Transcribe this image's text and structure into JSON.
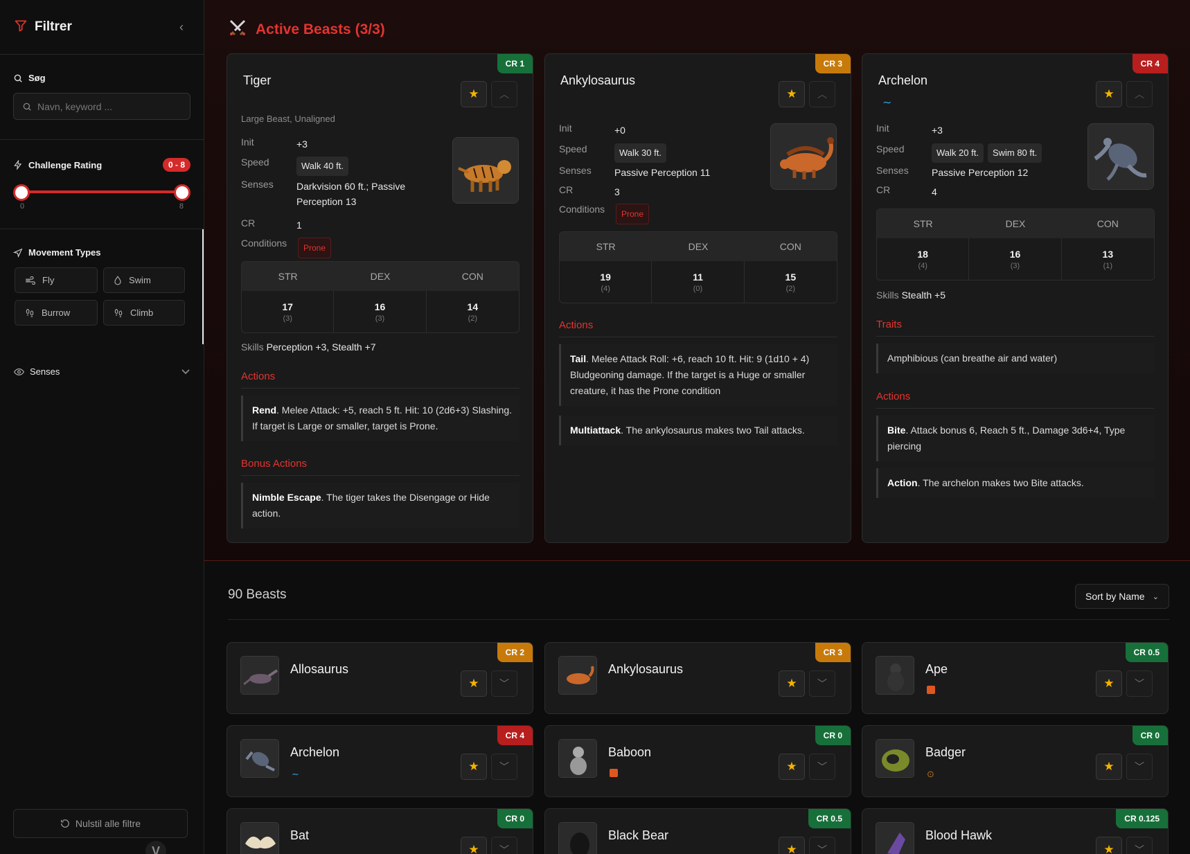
{
  "sidebar": {
    "title": "Filtrer",
    "search": {
      "label": "Søg",
      "placeholder": "Navn, keyword ..."
    },
    "challenge": {
      "label": "Challenge Rating",
      "badge": "0 - 8",
      "min_label": "0",
      "max_label": "8",
      "min_value": 0,
      "max_value": 8,
      "range_min": 0,
      "range_max": 8
    },
    "movement": {
      "label": "Movement Types",
      "types": [
        "Fly",
        "Swim",
        "Burrow",
        "Climb"
      ]
    },
    "senses": {
      "label": "Senses"
    },
    "reset_label": "Nulstil alle filtre",
    "logo_glyph": "V"
  },
  "active": {
    "title": "Active Beasts (3/3)",
    "cards": [
      {
        "name": "Tiger",
        "cr": "CR 1",
        "cr_color": "#17703a",
        "subtitle": "Large Beast, Unaligned",
        "init_label": "Init",
        "init": "+3",
        "speed_label": "Speed",
        "speeds": [
          "Walk 40 ft."
        ],
        "senses_label": "Senses",
        "senses": "Darkvision 60 ft.; Passive Perception 13",
        "cr_label": "CR",
        "cr_value": "1",
        "conditions_label": "Conditions",
        "conditions": "Prone",
        "abilities": {
          "headers": [
            "STR",
            "DEX",
            "CON"
          ],
          "values": [
            "17",
            "16",
            "14"
          ],
          "mods": [
            "(3)",
            "(3)",
            "(2)"
          ]
        },
        "skills_label": "Skills",
        "skills": "Perception +3, Stealth +7",
        "actions_title": "Actions",
        "actions": [
          {
            "name": "Rend",
            "text": ". Melee Attack: +5, reach 5 ft. Hit: 10 (2d6+3) Slashing. If target is Large or smaller, target is Prone."
          }
        ],
        "bonus_title": "Bonus Actions",
        "bonus": [
          {
            "name": "Nimble Escape",
            "text": ". The tiger takes the Disengage or Hide action."
          }
        ]
      },
      {
        "name": "Ankylosaurus",
        "cr": "CR 3",
        "cr_color": "#c77a0a",
        "init_label": "Init",
        "init": "+0",
        "speed_label": "Speed",
        "speeds": [
          "Walk 30 ft."
        ],
        "senses_label": "Senses",
        "senses": "Passive Perception 11",
        "cr_label": "CR",
        "cr_value": "3",
        "conditions_label": "Conditions",
        "conditions": "Prone",
        "abilities": {
          "headers": [
            "STR",
            "DEX",
            "CON"
          ],
          "values": [
            "19",
            "11",
            "15"
          ],
          "mods": [
            "(4)",
            "(0)",
            "(2)"
          ]
        },
        "actions_title": "Actions",
        "actions": [
          {
            "name": "Tail",
            "text": ". Melee Attack Roll: +6, reach 10 ft. Hit: 9 (1d10 + 4) Bludgeoning damage. If the target is a Huge or smaller creature, it has the Prone condition"
          },
          {
            "name": "Multiattack",
            "text": ". The ankylosaurus makes two Tail attacks."
          }
        ]
      },
      {
        "name": "Archelon",
        "cr": "CR 4",
        "cr_color": "#b81e1e",
        "init_label": "Init",
        "init": "+3",
        "speed_label": "Speed",
        "speeds": [
          "Walk 20 ft.",
          "Swim 80 ft."
        ],
        "senses_label": "Senses",
        "senses": "Passive Perception 12",
        "cr_label": "CR",
        "cr_value": "4",
        "abilities": {
          "headers": [
            "STR",
            "DEX",
            "CON"
          ],
          "values": [
            "18",
            "16",
            "13"
          ],
          "mods": [
            "(4)",
            "(3)",
            "(1)"
          ]
        },
        "skills_label": "Skills",
        "skills": "Stealth +5",
        "traits_title": "Traits",
        "traits": [
          {
            "text": "Amphibious (can breathe air and water)"
          }
        ],
        "actions_title": "Actions",
        "actions": [
          {
            "name": "Bite",
            "text": ". Attack bonus 6, Reach 5 ft., Damage 3d6+4, Type piercing"
          },
          {
            "name": "Action",
            "text": ". The archelon makes two Bite attacks."
          }
        ]
      }
    ]
  },
  "list": {
    "count_label": "90 Beasts",
    "sort_label": "Sort by Name",
    "items": [
      {
        "name": "Allosaurus",
        "cr": "CR 2",
        "cr_color": "#c77a0a",
        "tag": ""
      },
      {
        "name": "Ankylosaurus",
        "cr": "CR 3",
        "cr_color": "#c77a0a",
        "tag": ""
      },
      {
        "name": "Ape",
        "cr": "CR 0.5",
        "cr_color": "#17703a",
        "tag": "climb"
      },
      {
        "name": "Archelon",
        "cr": "CR 4",
        "cr_color": "#b81e1e",
        "tag": "swim"
      },
      {
        "name": "Baboon",
        "cr": "CR 0",
        "cr_color": "#17703a",
        "tag": "climb"
      },
      {
        "name": "Badger",
        "cr": "CR 0",
        "cr_color": "#17703a",
        "tag": "burrow"
      },
      {
        "name": "Bat",
        "cr": "CR 0",
        "cr_color": "#17703a",
        "tag": ""
      },
      {
        "name": "Black Bear",
        "cr": "CR 0.5",
        "cr_color": "#17703a",
        "tag": ""
      },
      {
        "name": "Blood Hawk",
        "cr": "CR 0.125",
        "cr_color": "#17703a",
        "tag": ""
      }
    ]
  },
  "colors": {
    "accent": "#e3342f",
    "star": "#f5b300"
  }
}
